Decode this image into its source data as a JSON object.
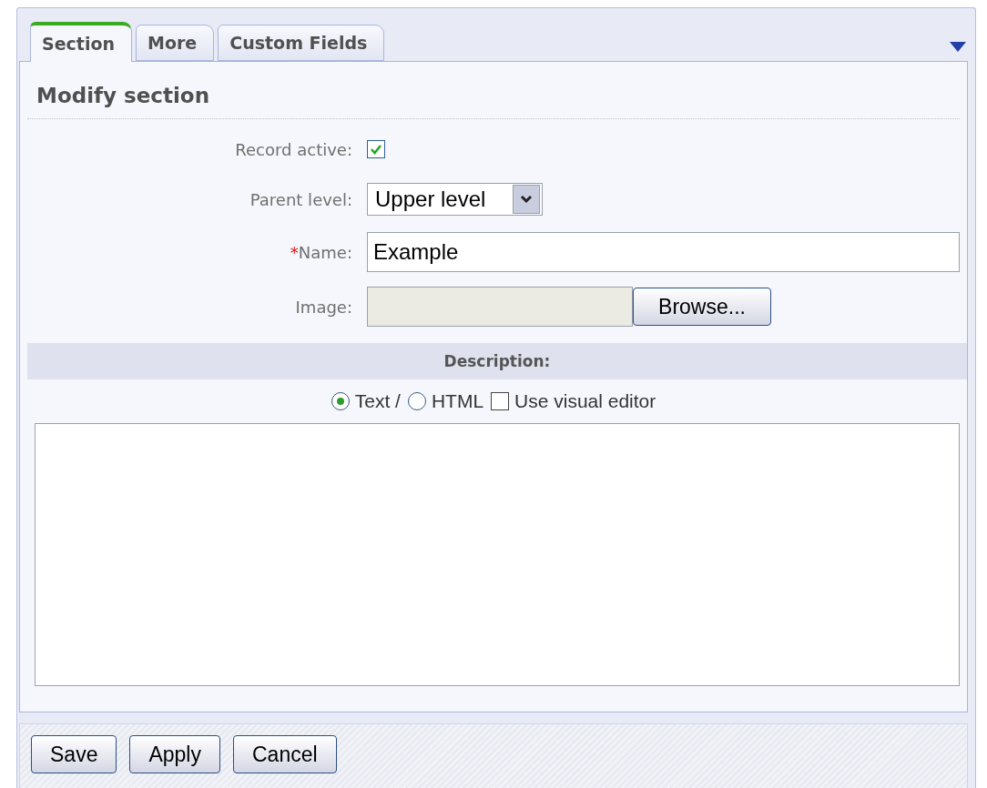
{
  "tabs": [
    {
      "label": "Section",
      "selected": true
    },
    {
      "label": "More",
      "selected": false
    },
    {
      "label": "Custom Fields",
      "selected": false
    }
  ],
  "heading": "Modify section",
  "fields": [
    {
      "kind": "checkbox",
      "label": "Record active:",
      "checked": true
    },
    {
      "kind": "select",
      "label": "Parent level:",
      "value": "Upper level"
    },
    {
      "kind": "text",
      "label": "Name:",
      "required_mark": "*",
      "value": "Example"
    },
    {
      "kind": "file",
      "label": "Image:",
      "button": "Browse..."
    }
  ],
  "description": {
    "title": "Description:",
    "options": [
      {
        "kind": "radio",
        "label": "Text /",
        "selected": true
      },
      {
        "kind": "radio",
        "label": "HTML",
        "selected": false
      },
      {
        "kind": "checkbox",
        "label": "Use visual editor",
        "checked": false
      }
    ]
  },
  "buttons": [
    "Save",
    "Apply",
    "Cancel"
  ]
}
